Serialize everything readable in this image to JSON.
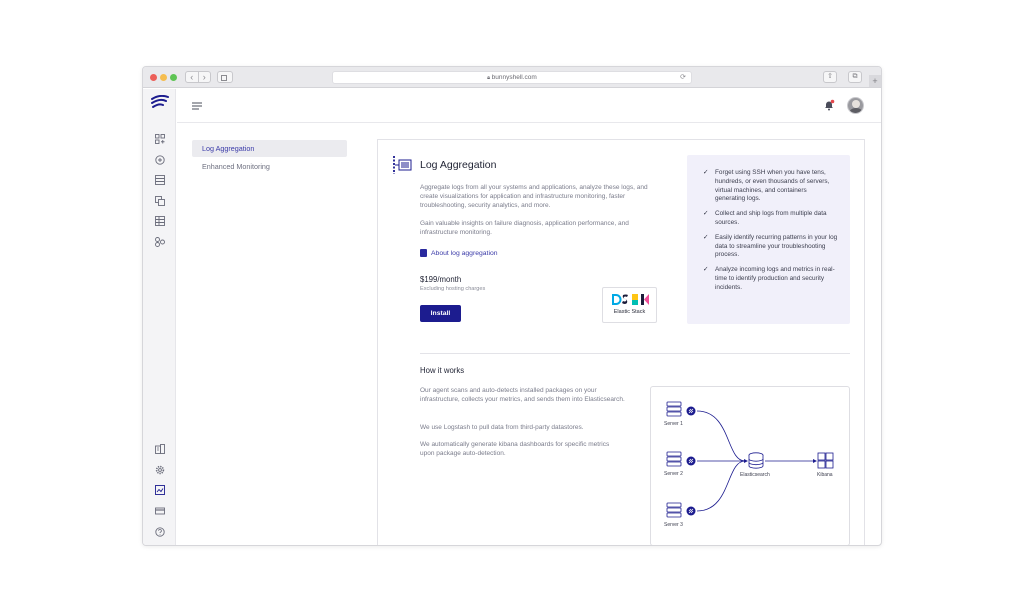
{
  "browser": {
    "url": "bunnyshell.com",
    "nav_back": "‹",
    "nav_forward": "›",
    "reload_icon": "⟳",
    "share_icon": "⇧",
    "tabs_icon": "⧉",
    "new_tab": "+"
  },
  "subnav": {
    "items": [
      {
        "label": "Log Aggregation",
        "active": true
      },
      {
        "label": "Enhanced Monitoring",
        "active": false
      }
    ]
  },
  "addon": {
    "title": "Log Aggregation",
    "description_1": "Aggregate logs from all your systems and applications, analyze these logs, and create visualizations for application and infrastructure monitoring, faster troubleshooting, security analytics, and more.",
    "description_2": "Gain valuable insights on failure diagnosis, application performance, and infrastructure monitoring.",
    "about_link": "About log aggregation",
    "price": "$199/month",
    "price_note": "Excluding hosting charges",
    "install_label": "Install",
    "stack_label": "Elastic Stack",
    "benefits": [
      "Forget using SSH when you have tens, hundreds, or even thousands of servers, virtual machines, and containers generating logs.",
      "Collect and ship logs from multiple data sources.",
      "Easily identify recurring patterns in your log data to streamline your troubleshooting process.",
      "Analyze incoming logs and metrics in real-time to identify production and security incidents."
    ]
  },
  "how_it_works": {
    "title": "How it works",
    "paragraphs": [
      "Our agent scans and auto-detects installed packages on your infrastructure, collects your metrics, and sends them into Elasticsearch.",
      "We use Logstash to pull data from third-party datastores.",
      "We automatically generate kibana dashboards for specific metrics upon package auto-detection."
    ],
    "diagram": {
      "servers": [
        "Server 1",
        "Server 2",
        "Server 3"
      ],
      "hub": "Elasticsearch",
      "target": "Kibana"
    }
  },
  "colors": {
    "brand": "#1c1c8f",
    "accent_link": "#3a3aa8",
    "benefits_bg": "#f1f0fa"
  },
  "icons": {
    "rail": [
      "dashboard-icon",
      "add-circle-icon",
      "list-icon",
      "copy-icon",
      "table-icon",
      "integrations-icon",
      "building-icon",
      "settings-icon",
      "image-icon",
      "billing-icon",
      "help-icon"
    ],
    "top": [
      "menu-icon",
      "notification-bell-icon",
      "user-avatar"
    ]
  }
}
